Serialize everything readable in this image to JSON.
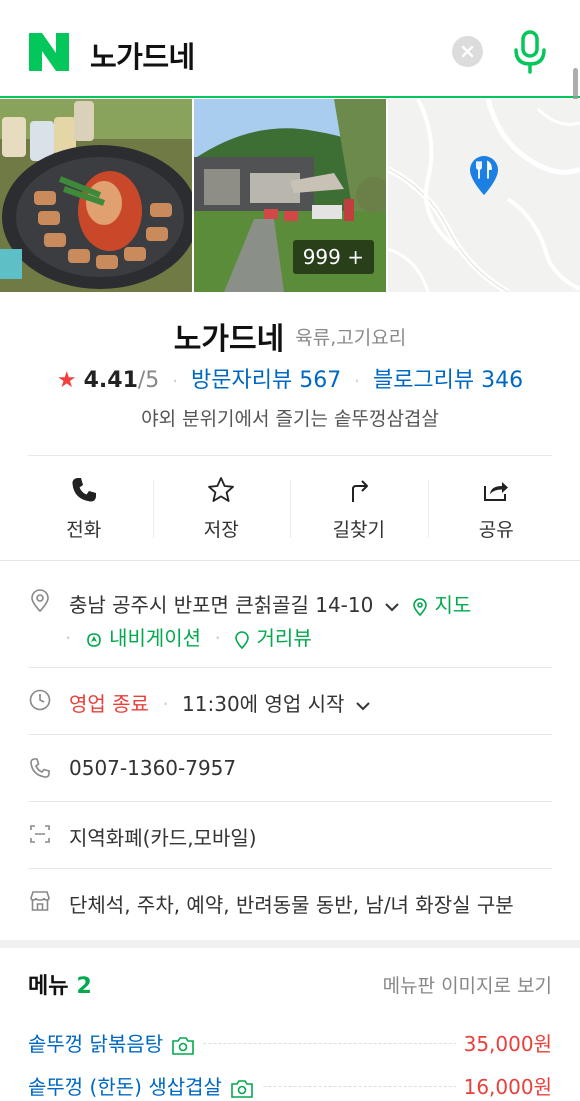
{
  "search": {
    "query": "노가드네"
  },
  "photos": {
    "count_label": "999 +"
  },
  "place": {
    "name": "노가드네",
    "category": "육류,고기요리",
    "rating": "4.41",
    "rating_max": "/5",
    "visitor_review_label": "방문자리뷰 567",
    "blog_review_label": "블로그리뷰 346",
    "description": "야외 분위기에서 즐기는 솥뚜껑삼겹살"
  },
  "actions": [
    {
      "label": "전화",
      "icon": "phone-icon"
    },
    {
      "label": "저장",
      "icon": "star-icon"
    },
    {
      "label": "길찾기",
      "icon": "directions-icon"
    },
    {
      "label": "공유",
      "icon": "share-icon"
    }
  ],
  "details": {
    "address": "충남 공주시 반포면 큰칡골길 14-10",
    "map_link": "지도",
    "navigation_link": "내비게이션",
    "street_view_link": "거리뷰",
    "status": "영업 종료",
    "hours": "11:30에 영업 시작",
    "phone": "0507-1360-7957",
    "payment": "지역화폐(카드,모바일)",
    "amenities": "단체석, 주차, 예약, 반려동물 동반, 남/녀 화장실 구분"
  },
  "menu": {
    "title": "메뉴",
    "count": "2",
    "image_link": "메뉴판 이미지로 보기",
    "items": [
      {
        "name": "솥뚜껑 닭볶음탕",
        "price": "35,000원"
      },
      {
        "name": "솥뚜껑 (한돈) 생삽겹살",
        "price": "16,000원"
      }
    ]
  },
  "colors": {
    "brand_green": "#03c75a",
    "link_blue": "#0068c3",
    "price_red": "#e8403b"
  }
}
